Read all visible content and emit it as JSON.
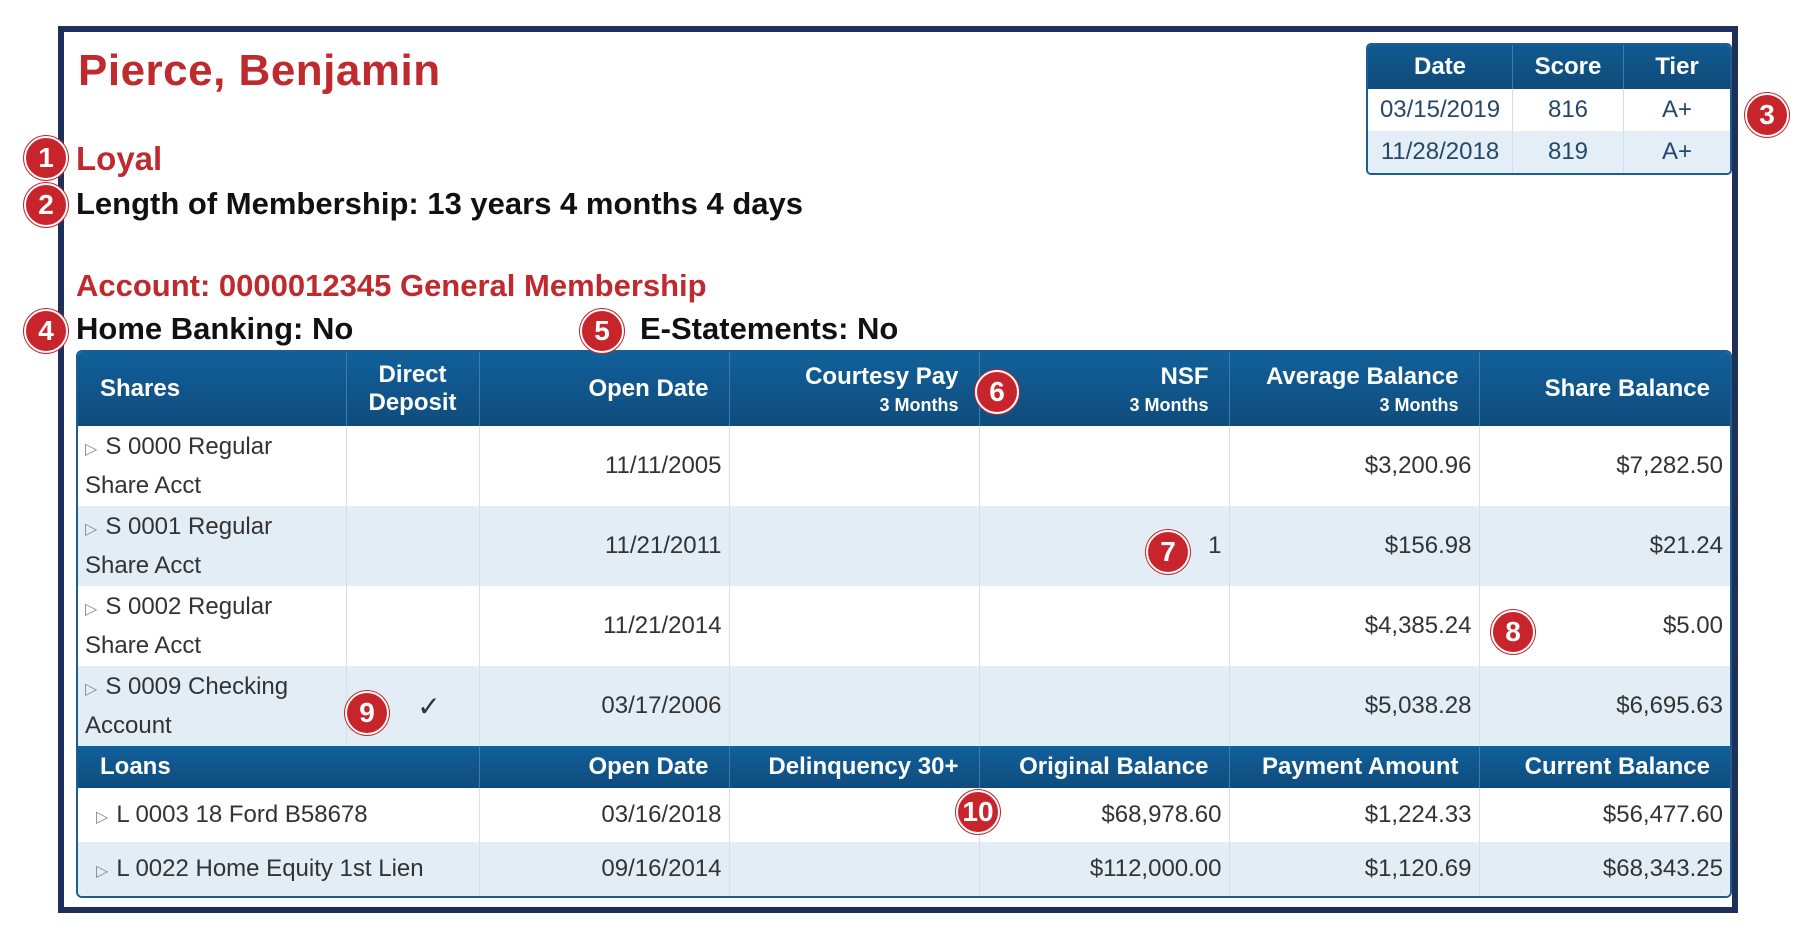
{
  "member": {
    "name": "Pierce, Benjamin",
    "status": "Loyal",
    "length_of_membership": "Length of Membership: 13 years 4 months 4 days"
  },
  "account": {
    "title": "Account: 0000012345 General Membership",
    "home_banking": "Home Banking: No",
    "e_statements": "E-Statements: No"
  },
  "score_table": {
    "headers": [
      "Date",
      "Score",
      "Tier"
    ],
    "rows": [
      {
        "date": "03/15/2019",
        "score": "816",
        "tier": "A+"
      },
      {
        "date": "11/28/2018",
        "score": "819",
        "tier": "A+"
      }
    ]
  },
  "shares_table": {
    "headers": {
      "shares": "Shares",
      "direct_deposit_1": "Direct",
      "direct_deposit_2": "Deposit",
      "open_date": "Open Date",
      "courtesy_pay": "Courtesy Pay",
      "courtesy_pay_sub": "3 Months",
      "nsf": "NSF",
      "nsf_sub": "3 Months",
      "average_balance": "Average Balance",
      "average_balance_sub": "3 Months",
      "share_balance": "Share Balance"
    },
    "rows": [
      {
        "name_1": "S 0000 Regular",
        "name_2": "Share Acct",
        "direct_deposit": "",
        "open_date": "11/11/2005",
        "courtesy_pay": "",
        "nsf": "",
        "average_balance": "$3,200.96",
        "share_balance": "$7,282.50"
      },
      {
        "name_1": "S 0001 Regular",
        "name_2": "Share Acct",
        "direct_deposit": "",
        "open_date": "11/21/2011",
        "courtesy_pay": "",
        "nsf": "1",
        "average_balance": "$156.98",
        "share_balance": "$21.24"
      },
      {
        "name_1": "S 0002 Regular",
        "name_2": "Share Acct",
        "direct_deposit": "",
        "open_date": "11/21/2014",
        "courtesy_pay": "",
        "nsf": "",
        "average_balance": "$4,385.24",
        "share_balance": "$5.00"
      },
      {
        "name_1": "S 0009 Checking",
        "name_2": "Account",
        "direct_deposit": "✓",
        "open_date": "03/17/2006",
        "courtesy_pay": "",
        "nsf": "",
        "average_balance": "$5,038.28",
        "share_balance": "$6,695.63"
      }
    ]
  },
  "loans_table": {
    "headers": {
      "loans": "Loans",
      "open_date": "Open Date",
      "delinquency": "Delinquency 30+",
      "original_balance": "Original Balance",
      "payment_amount": "Payment Amount",
      "current_balance": "Current Balance"
    },
    "rows": [
      {
        "name": "L 0003 18 Ford B58678",
        "open_date": "03/16/2018",
        "delinquency": "",
        "original_balance": "$68,978.60",
        "payment_amount": "$1,224.33",
        "current_balance": "$56,477.60"
      },
      {
        "name": "L 0022 Home Equity 1st Lien",
        "open_date": "09/16/2014",
        "delinquency": "",
        "original_balance": "$112,000.00",
        "payment_amount": "$1,120.69",
        "current_balance": "$68,343.25"
      }
    ]
  },
  "callouts": [
    "1",
    "2",
    "3",
    "4",
    "5",
    "6",
    "7",
    "8",
    "9",
    "10"
  ],
  "icons": {
    "expand": "triangle-right-icon",
    "check": "checkmark-icon"
  },
  "colors": {
    "accent_red": "#bf2a2e",
    "header_blue": "#0f5a91",
    "frame": "#1e3057",
    "row_alt": "#e3edf5"
  }
}
